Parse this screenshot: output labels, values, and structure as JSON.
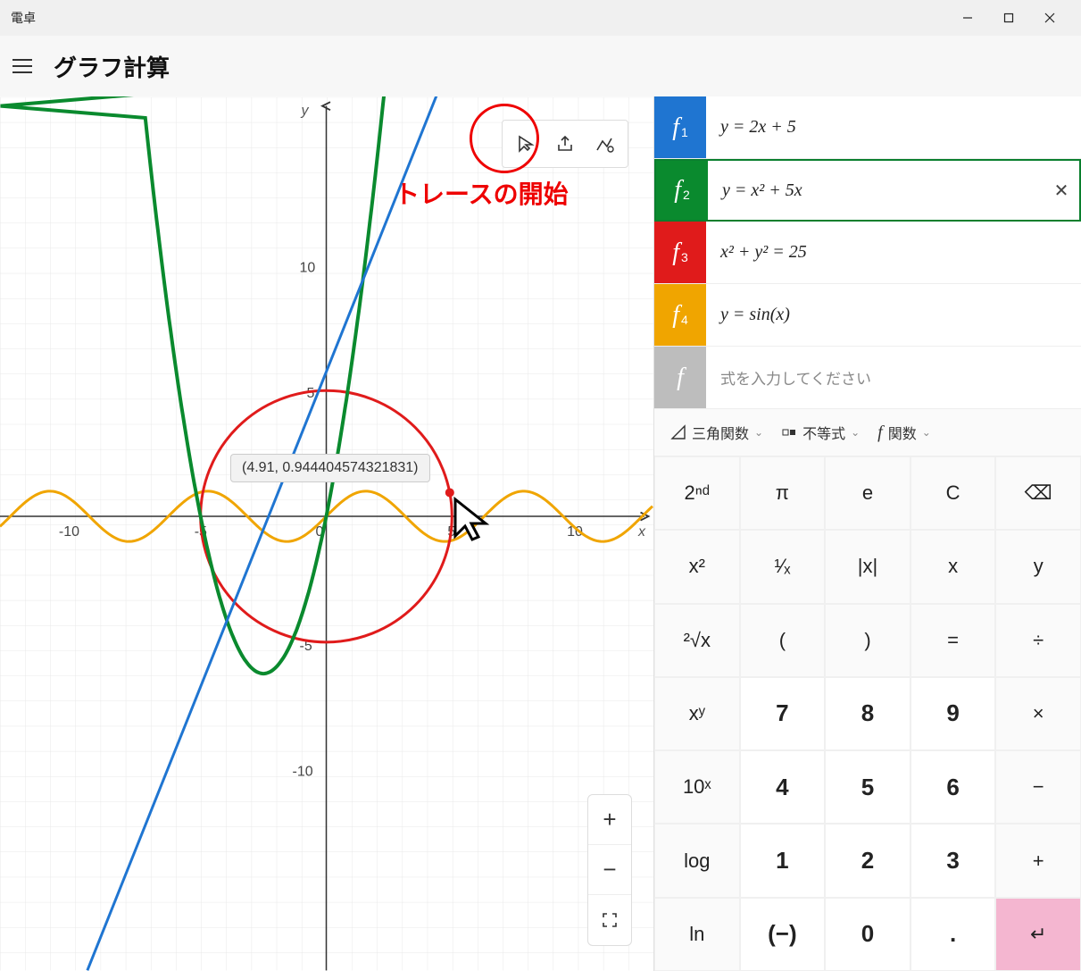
{
  "window": {
    "title": "電卓"
  },
  "header": {
    "mode": "グラフ計算"
  },
  "graph": {
    "axis_y_label": "y",
    "axis_x_label": "x",
    "ticks_x": [
      "-10",
      "-5",
      "0",
      "5",
      "10"
    ],
    "tick_y_pos10": "10",
    "tick_y_pos5": "5",
    "tick_y_neg5": "-5",
    "tick_y_neg10": "-10",
    "trace_tooltip": "(4.91, 0.944404574321831)",
    "trace_annotation": "トレースの開始"
  },
  "equations": [
    {
      "sub": "1",
      "color": "#1f75d1",
      "text": "y = 2x + 5"
    },
    {
      "sub": "2",
      "color": "#0a8a2e",
      "text": "y = x² + 5x",
      "selected": true
    },
    {
      "sub": "3",
      "color": "#e01b1b",
      "text": "x² + y² = 25"
    },
    {
      "sub": "4",
      "color": "#f0a500",
      "text": "y = sin(x)"
    }
  ],
  "placeholder_eq": "式を入力してください",
  "categories": {
    "trig": "三角関数",
    "ineq": "不等式",
    "func": "関数"
  },
  "keys": {
    "r0": [
      "2ⁿᵈ",
      "π",
      "e",
      "C",
      "⌫"
    ],
    "r1": [
      "x²",
      "¹⁄ₓ",
      "|x|",
      "x",
      "y"
    ],
    "r2": [
      "²√x",
      "(",
      ")",
      "=",
      "÷"
    ],
    "r3": [
      "xʸ",
      "7",
      "8",
      "9",
      "×"
    ],
    "r4": [
      "10ˣ",
      "4",
      "5",
      "6",
      "−"
    ],
    "r5": [
      "log",
      "1",
      "2",
      "3",
      "+"
    ],
    "r6": [
      "ln",
      "(−)",
      "0",
      ".",
      "↵"
    ]
  },
  "zoom": {
    "in": "+",
    "out": "−",
    "fit": "⛶"
  },
  "chart_data": {
    "type": "line",
    "xlim": [
      -13,
      13
    ],
    "ylim": [
      -14,
      14
    ],
    "xlabel": "x",
    "ylabel": "y",
    "xticks": [
      -10,
      -5,
      0,
      5,
      10
    ],
    "yticks": [
      -10,
      -5,
      5,
      10
    ],
    "series": [
      {
        "name": "y=2x+5",
        "color": "#1f75d1",
        "type": "line",
        "x": [
          -9.5,
          4.5
        ],
        "y": [
          -14,
          14
        ]
      },
      {
        "name": "y=x²+5x",
        "color": "#0a8a2e",
        "type": "parabola",
        "vertex": [
          -2.5,
          -6.25
        ],
        "roots": [
          -5,
          0
        ],
        "x_range": [
          -6.85,
          1.85
        ]
      },
      {
        "name": "x²+y²=25",
        "color": "#e01b1b",
        "type": "circle",
        "cx": 0,
        "cy": 0,
        "r": 5
      },
      {
        "name": "y=sin(x)",
        "color": "#f0a500",
        "type": "sine",
        "amplitude": 1,
        "period": 6.2832,
        "x_range": [
          -13,
          13
        ]
      }
    ],
    "trace_point": {
      "x": 4.91,
      "y": 0.944404574321831
    }
  }
}
